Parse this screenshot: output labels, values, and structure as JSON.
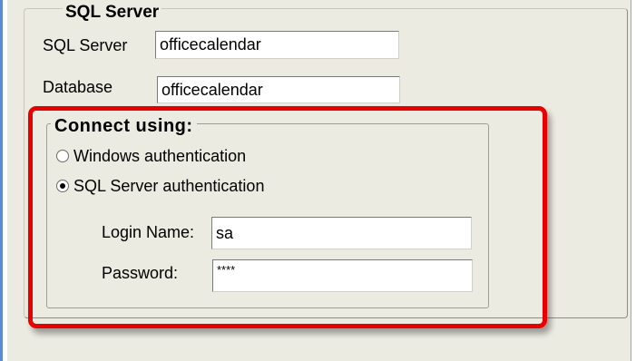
{
  "sql_group": {
    "title": "SQL Server",
    "server_label": "SQL Server",
    "server_value": "officecalendar",
    "database_label": "Database",
    "database_value": "officecalendar"
  },
  "connect_group": {
    "title": "Connect using:",
    "windows_auth_label": "Windows authentication",
    "windows_auth_selected": false,
    "sql_auth_label": "SQL Server authentication",
    "sql_auth_selected": true,
    "login_label": "Login Name:",
    "login_value": "sa",
    "password_label": "Password:",
    "password_value": "****"
  },
  "annotation": {
    "highlight_color": "#e80000"
  }
}
